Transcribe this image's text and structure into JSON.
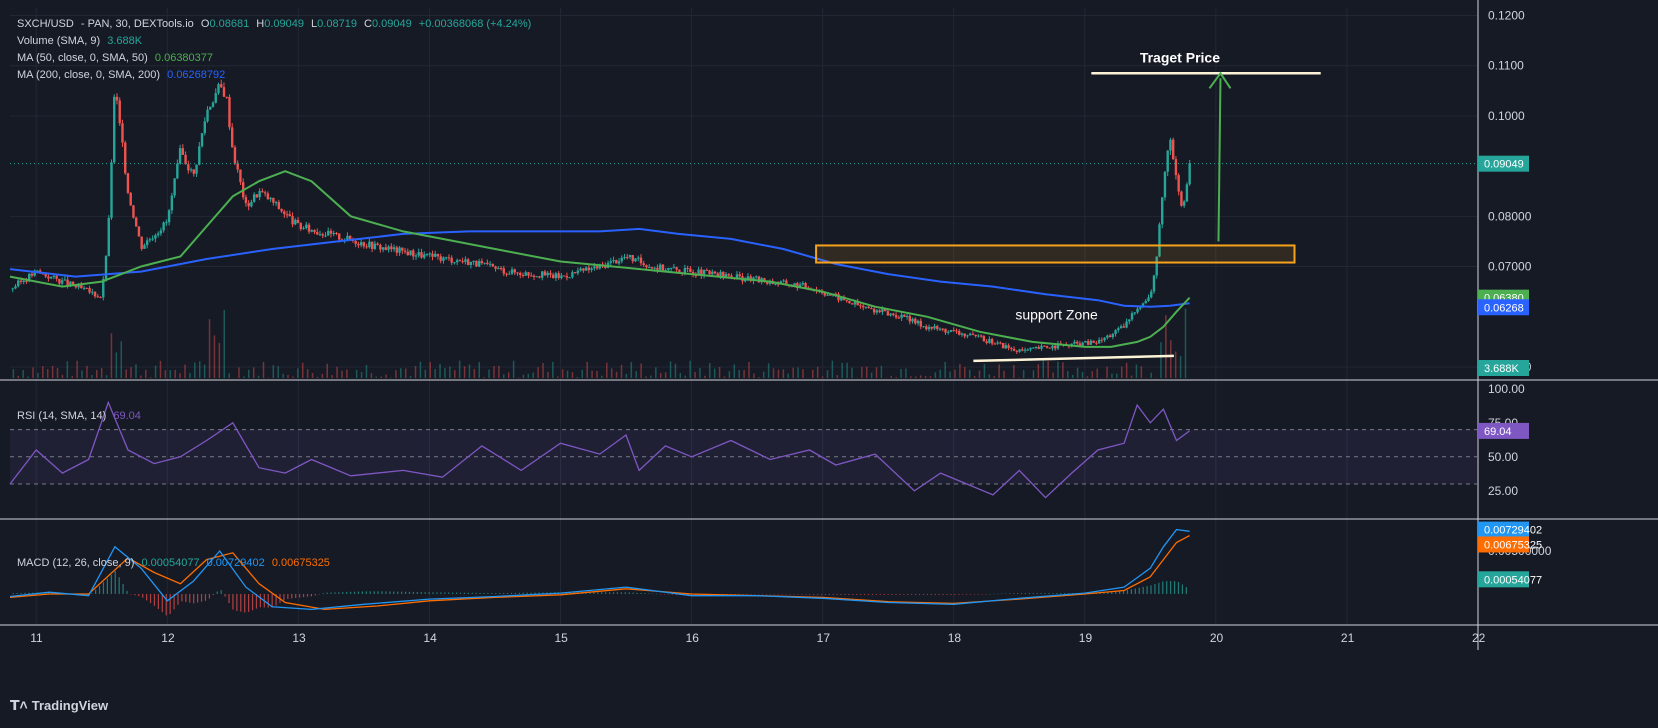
{
  "legend": {
    "symbol": "SXCH/USD",
    "exchange": "- PAN, 30, DEXTools.io",
    "o_label": "O",
    "o": "0.08681",
    "h_label": "H",
    "h": "0.09049",
    "l_label": "L",
    "l": "0.08719",
    "c_label": "C",
    "c": "0.09049",
    "change": "+0.00368068 (+4.24%)",
    "volume_label": "Volume (SMA, 9)",
    "volume_value": "3.688K",
    "ma50_label": "MA (50, close, 0, SMA, 50)",
    "ma50_value": "0.06380377",
    "ma200_label": "MA (200, close, 0, SMA, 200)",
    "ma200_value": "0.06268792",
    "rsi_label": "RSI (14, SMA, 14)",
    "rsi_value": "69.04",
    "macd_label": "MACD (12, 26, close, 9)",
    "macd_hist": "0.00054077",
    "macd_line": "0.00729402",
    "macd_signal": "0.00675325"
  },
  "colors": {
    "background": "#161a25",
    "up": "#26a69a",
    "down": "#ef5350",
    "ma50": "#4caf50",
    "ma200": "#2962ff",
    "rsi": "#7e57c2",
    "macd": "#2196f3",
    "signal": "#ff6d00",
    "zone": "#f7a21b"
  },
  "chart_data": [
    {
      "type": "line",
      "panel": "price",
      "title": "SXCH/USD - PAN, 30, DEXTools.io",
      "x_ticks": [
        "11",
        "12",
        "13",
        "14",
        "15",
        "16",
        "17",
        "18",
        "19",
        "20",
        "21",
        "22"
      ],
      "y_ticks": [
        "0.1200",
        "0.1100",
        "0.1000",
        "0.08000",
        "0.07000",
        "0.05000"
      ],
      "ylim": [
        0.0478,
        0.1215
      ],
      "xlim": [
        10.8,
        22.0
      ],
      "price_series_x": [
        10.8,
        11.0,
        11.3,
        11.5,
        11.55,
        11.6,
        11.7,
        11.8,
        12.0,
        12.1,
        12.2,
        12.3,
        12.4,
        12.45,
        12.5,
        12.6,
        12.7,
        12.8,
        13.0,
        13.3,
        13.6,
        14.0,
        14.3,
        14.6,
        15.0,
        15.3,
        15.5,
        15.7,
        16.0,
        16.3,
        16.6,
        16.9,
        17.1,
        17.3,
        17.6,
        17.8,
        18.0,
        18.3,
        18.5,
        18.7,
        18.9,
        19.1,
        19.3,
        19.4,
        19.5,
        19.55,
        19.6,
        19.65,
        19.7,
        19.75,
        19.8
      ],
      "price_series_y": [
        0.0655,
        0.069,
        0.066,
        0.064,
        0.077,
        0.106,
        0.085,
        0.074,
        0.079,
        0.093,
        0.088,
        0.101,
        0.106,
        0.104,
        0.093,
        0.082,
        0.085,
        0.083,
        0.078,
        0.076,
        0.074,
        0.072,
        0.071,
        0.069,
        0.068,
        0.07,
        0.072,
        0.07,
        0.069,
        0.068,
        0.067,
        0.066,
        0.064,
        0.062,
        0.06,
        0.058,
        0.057,
        0.055,
        0.053,
        0.054,
        0.0545,
        0.055,
        0.058,
        0.062,
        0.064,
        0.072,
        0.087,
        0.096,
        0.088,
        0.081,
        0.0905
      ],
      "ma50": {
        "name": "MA (50, close, 0, SMA, 50)",
        "x": [
          10.8,
          11.2,
          11.5,
          11.8,
          12.1,
          12.3,
          12.5,
          12.7,
          12.9,
          13.1,
          13.4,
          13.8,
          14.2,
          14.6,
          15.0,
          15.4,
          15.8,
          16.2,
          16.6,
          17.0,
          17.4,
          17.8,
          18.2,
          18.6,
          19.0,
          19.2,
          19.4,
          19.5,
          19.6,
          19.7,
          19.8
        ],
        "y": [
          0.068,
          0.066,
          0.067,
          0.07,
          0.072,
          0.078,
          0.084,
          0.087,
          0.089,
          0.087,
          0.08,
          0.077,
          0.075,
          0.073,
          0.071,
          0.07,
          0.069,
          0.068,
          0.067,
          0.065,
          0.062,
          0.06,
          0.057,
          0.055,
          0.054,
          0.054,
          0.055,
          0.056,
          0.058,
          0.061,
          0.0638
        ]
      },
      "ma200": {
        "name": "MA (200, close, 0, SMA, 200)",
        "x": [
          10.8,
          11.3,
          11.8,
          12.3,
          12.8,
          13.3,
          13.8,
          14.3,
          14.8,
          15.3,
          15.6,
          15.9,
          16.3,
          16.7,
          17.1,
          17.5,
          17.9,
          18.3,
          18.7,
          19.1,
          19.3,
          19.5,
          19.65,
          19.8
        ],
        "y": [
          0.0695,
          0.068,
          0.069,
          0.0715,
          0.0735,
          0.075,
          0.0765,
          0.077,
          0.077,
          0.077,
          0.0775,
          0.0765,
          0.0755,
          0.0735,
          0.0705,
          0.0685,
          0.067,
          0.066,
          0.0645,
          0.0633,
          0.0622,
          0.062,
          0.0622,
          0.0627
        ]
      },
      "last_price": "0.09049",
      "annotations": [
        "Traget  Price",
        "support Zone"
      ],
      "volume_last": "3.688K"
    },
    {
      "type": "line",
      "panel": "rsi",
      "title": "RSI (14, SMA, 14)",
      "y_ticks": [
        "100.00",
        "75.00",
        "50.00",
        "25.00"
      ],
      "ylim": [
        5,
        105
      ],
      "x": [
        10.8,
        11.0,
        11.2,
        11.4,
        11.55,
        11.7,
        11.9,
        12.1,
        12.3,
        12.5,
        12.7,
        12.9,
        13.1,
        13.4,
        13.8,
        14.1,
        14.4,
        14.7,
        15.0,
        15.3,
        15.5,
        15.6,
        15.8,
        16.0,
        16.3,
        16.6,
        16.9,
        17.1,
        17.4,
        17.7,
        17.9,
        18.1,
        18.3,
        18.5,
        18.7,
        18.9,
        19.1,
        19.3,
        19.4,
        19.5,
        19.6,
        19.7,
        19.8
      ],
      "y": [
        30,
        55,
        38,
        48,
        90,
        55,
        45,
        50,
        62,
        75,
        42,
        38,
        48,
        36,
        40,
        35,
        58,
        40,
        60,
        52,
        66,
        40,
        58,
        50,
        62,
        48,
        55,
        44,
        52,
        25,
        38,
        30,
        22,
        40,
        20,
        38,
        55,
        60,
        88,
        75,
        85,
        62,
        69.04
      ],
      "last": "69.04"
    },
    {
      "type": "line",
      "panel": "macd",
      "title": "MACD (12, 26, close, 9)",
      "y_ticks": [
        "0.00500000"
      ],
      "ylim": [
        -0.0035,
        0.0085
      ],
      "macd": {
        "x": [
          10.8,
          11.1,
          11.4,
          11.6,
          11.8,
          12.0,
          12.2,
          12.4,
          12.6,
          12.8,
          13.1,
          13.5,
          14.0,
          14.5,
          15.0,
          15.5,
          16.0,
          16.5,
          17.0,
          17.5,
          18.0,
          18.5,
          19.0,
          19.3,
          19.5,
          19.6,
          19.7,
          19.8
        ],
        "y": [
          -0.0003,
          0.0002,
          -0.0002,
          0.0055,
          0.003,
          -0.0008,
          0.0015,
          0.005,
          0.0008,
          -0.0015,
          -0.0018,
          -0.0012,
          -0.0006,
          -0.0003,
          0.0001,
          0.0008,
          -0.0002,
          -0.0002,
          -0.0005,
          -0.001,
          -0.0012,
          -0.0005,
          0.0001,
          0.0008,
          0.003,
          0.0055,
          0.0075,
          0.0073
        ]
      },
      "signal": {
        "x": [
          10.8,
          11.1,
          11.4,
          11.7,
          11.9,
          12.1,
          12.3,
          12.5,
          12.7,
          12.9,
          13.2,
          13.6,
          14.0,
          14.5,
          15.0,
          15.5,
          16.0,
          16.5,
          17.0,
          17.5,
          18.0,
          18.5,
          19.0,
          19.3,
          19.5,
          19.6,
          19.7,
          19.8
        ],
        "y": [
          -0.0004,
          0.0,
          0.0,
          0.0042,
          0.0025,
          0.0012,
          0.004,
          0.0048,
          0.0012,
          -0.001,
          -0.0018,
          -0.0014,
          -0.0008,
          -0.0004,
          -0.0001,
          0.0006,
          0.0,
          -0.0002,
          -0.0004,
          -0.0009,
          -0.0011,
          -0.0006,
          0.0,
          0.0004,
          0.002,
          0.004,
          0.006,
          0.0068
        ]
      },
      "hist_last": "0.00054077",
      "macd_last": "0.00729402",
      "signal_last": "0.00675325"
    }
  ],
  "brand": "TradingView"
}
